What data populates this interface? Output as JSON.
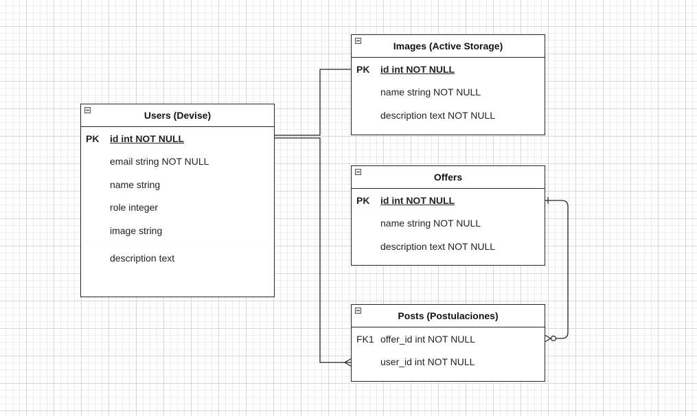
{
  "diagram": {
    "entities": [
      {
        "id": "users",
        "title": "Users (Devise)",
        "rows": [
          {
            "key": "PK",
            "field": "id int NOT NULL",
            "primary": true
          },
          {
            "key": "",
            "field": "email string NOT NULL",
            "primary": false
          },
          {
            "key": "",
            "field": "name string",
            "primary": false
          },
          {
            "key": "",
            "field": "role integer",
            "primary": false
          },
          {
            "key": "",
            "field": "image string",
            "primary": false
          },
          {
            "key": "",
            "field": "description text",
            "primary": false
          }
        ]
      },
      {
        "id": "images",
        "title": "Images (Active Storage)",
        "rows": [
          {
            "key": "PK",
            "field": "id int NOT NULL",
            "primary": true
          },
          {
            "key": "",
            "field": "name string NOT NULL",
            "primary": false
          },
          {
            "key": "",
            "field": "description text NOT NULL",
            "primary": false
          }
        ]
      },
      {
        "id": "offers",
        "title": "Offers",
        "rows": [
          {
            "key": "PK",
            "field": "id int NOT NULL",
            "primary": true
          },
          {
            "key": "",
            "field": "name string NOT NULL",
            "primary": false
          },
          {
            "key": "",
            "field": "description text NOT NULL",
            "primary": false
          }
        ]
      },
      {
        "id": "posts",
        "title": "Posts (Postulaciones)",
        "rows": [
          {
            "key": "FK1",
            "field": "offer_id int NOT NULL",
            "primary": false
          },
          {
            "key": "",
            "field": "user_id int NOT NULL",
            "primary": false
          }
        ]
      }
    ],
    "relations": [
      {
        "from": "users",
        "to": "images",
        "from_end": "none",
        "to_end": "none"
      },
      {
        "from": "users",
        "to": "posts",
        "from_end": "none",
        "to_end": "many"
      },
      {
        "from": "offers",
        "to": "posts",
        "from_end": "one",
        "to_end": "zero-or-many"
      }
    ],
    "colors": {
      "line": "#222222",
      "grid_major": "#d6d6d6",
      "grid_minor": "#ececec"
    }
  }
}
